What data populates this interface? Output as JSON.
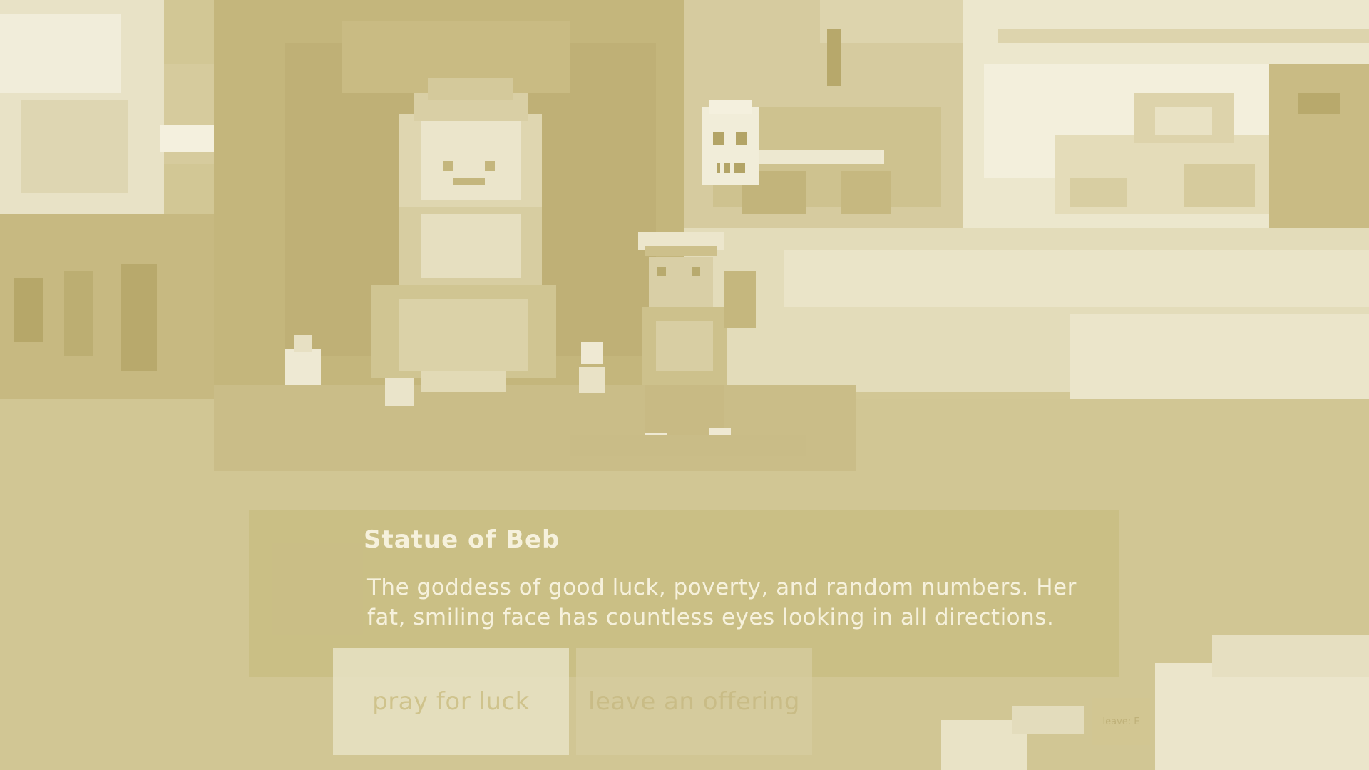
{
  "dialog": {
    "title": "Statue of Beb",
    "body": "The goddess of good luck, poverty, and random numbers. Her fat, smiling face has countless eyes looking in all directions."
  },
  "choices": [
    {
      "label": "pray for luck"
    },
    {
      "label": "leave an offering"
    }
  ],
  "hint": {
    "label": "leave: E"
  },
  "palette": {
    "sky": "#f2eedb",
    "ground": "#d3c899",
    "shadow": "#c2b47c",
    "dark": "#b9aa6c",
    "light": "#ece6c8",
    "text": "#f6f1dc"
  }
}
